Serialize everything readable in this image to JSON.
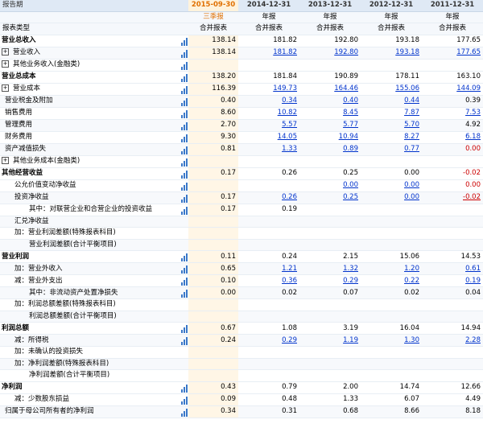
{
  "header": {
    "period_label": "报告期",
    "type_label": "报表类型",
    "periods": [
      "2015-09-30",
      "2014-12-31",
      "2013-12-31",
      "2012-12-31",
      "2011-12-31"
    ],
    "period_types": [
      "三季报",
      "年报",
      "年报",
      "年报",
      "年报"
    ],
    "report_types": [
      "合并报表",
      "合并报表",
      "合并报表",
      "合并报表",
      "合并报表"
    ]
  },
  "rows": [
    {
      "label": "营业总收入",
      "indent": 0,
      "bold": true,
      "expand": false,
      "chart": true,
      "values": [
        "138.14",
        "181.82",
        "192.80",
        "193.18",
        "177.65"
      ],
      "links": [
        false,
        false,
        false,
        false,
        false
      ]
    },
    {
      "label": "营业收入",
      "indent": 1,
      "bold": false,
      "expand": true,
      "chart": true,
      "values": [
        "138.14",
        "181.82",
        "192.80",
        "193.18",
        "177.65"
      ],
      "links": [
        false,
        true,
        true,
        true,
        true
      ]
    },
    {
      "label": "其他业务收入(金融类)",
      "indent": 1,
      "bold": false,
      "expand": true,
      "chart": true,
      "values": [
        "",
        "",
        "",
        "",
        ""
      ],
      "links": [
        false,
        false,
        false,
        false,
        false
      ]
    },
    {
      "label": "营业总成本",
      "indent": 0,
      "bold": true,
      "expand": false,
      "chart": true,
      "values": [
        "138.20",
        "181.84",
        "190.89",
        "178.11",
        "163.10"
      ],
      "links": [
        false,
        false,
        false,
        false,
        false
      ]
    },
    {
      "label": "营业成本",
      "indent": 1,
      "bold": false,
      "expand": true,
      "chart": true,
      "values": [
        "116.39",
        "149.73",
        "164.46",
        "155.06",
        "144.09"
      ],
      "links": [
        false,
        true,
        true,
        true,
        true
      ]
    },
    {
      "label": "营业税金及附加",
      "indent": 1,
      "bold": false,
      "expand": false,
      "chart": true,
      "values": [
        "0.40",
        "0.34",
        "0.40",
        "0.44",
        "0.39"
      ],
      "links": [
        false,
        true,
        true,
        true,
        false
      ]
    },
    {
      "label": "销售费用",
      "indent": 1,
      "bold": false,
      "expand": false,
      "chart": true,
      "values": [
        "8.60",
        "10.82",
        "8.45",
        "7.87",
        "7.53"
      ],
      "links": [
        false,
        true,
        true,
        true,
        true
      ]
    },
    {
      "label": "管理费用",
      "indent": 1,
      "bold": false,
      "expand": false,
      "chart": true,
      "values": [
        "2.70",
        "5.57",
        "5.77",
        "5.70",
        "4.92"
      ],
      "links": [
        false,
        true,
        true,
        true,
        false
      ]
    },
    {
      "label": "财务费用",
      "indent": 1,
      "bold": false,
      "expand": false,
      "chart": true,
      "values": [
        "9.30",
        "14.05",
        "10.94",
        "8.27",
        "6.18"
      ],
      "links": [
        false,
        true,
        true,
        true,
        true
      ]
    },
    {
      "label": "资产减值损失",
      "indent": 1,
      "bold": false,
      "expand": false,
      "chart": true,
      "values": [
        "0.81",
        "1.33",
        "0.89",
        "0.77",
        "0.00"
      ],
      "links": [
        false,
        true,
        true,
        true,
        false
      ],
      "neg": [
        false,
        false,
        false,
        false,
        true
      ]
    },
    {
      "label": "其他业务成本(金融类)",
      "indent": 1,
      "bold": false,
      "expand": true,
      "chart": true,
      "values": [
        "",
        "",
        "",
        "",
        ""
      ],
      "links": [
        false,
        false,
        false,
        false,
        false
      ]
    },
    {
      "label": "其他经营收益",
      "indent": 0,
      "bold": true,
      "expand": false,
      "chart": true,
      "values": [
        "0.17",
        "0.26",
        "0.25",
        "0.00",
        "-0.02"
      ],
      "links": [
        false,
        false,
        false,
        false,
        false
      ],
      "neg": [
        false,
        false,
        false,
        false,
        true
      ]
    },
    {
      "label": "公允价值变动净收益",
      "indent": 2,
      "bold": false,
      "expand": false,
      "chart": true,
      "values": [
        "",
        "",
        "0.00",
        "0.00",
        "0.00"
      ],
      "links": [
        false,
        false,
        true,
        true,
        false
      ],
      "neg": [
        false,
        false,
        false,
        false,
        true
      ]
    },
    {
      "label": "投资净收益",
      "indent": 2,
      "bold": false,
      "expand": false,
      "chart": true,
      "values": [
        "0.17",
        "0.26",
        "0.25",
        "0.00",
        "-0.02"
      ],
      "links": [
        false,
        true,
        true,
        true,
        true
      ],
      "neg": [
        false,
        false,
        false,
        false,
        true
      ]
    },
    {
      "label": "其中：对联营企业和合营企业的投资收益",
      "indent": 3,
      "bold": false,
      "expand": false,
      "chart": true,
      "values": [
        "0.17",
        "0.19",
        "",
        "",
        ""
      ],
      "links": [
        false,
        false,
        false,
        false,
        false
      ]
    },
    {
      "label": "汇兑净收益",
      "indent": 2,
      "bold": false,
      "expand": false,
      "chart": false,
      "values": [
        "",
        "",
        "",
        "",
        ""
      ],
      "links": [
        false,
        false,
        false,
        false,
        false
      ]
    },
    {
      "label": "加：营业利润差额(特殊报表科目)",
      "indent": 2,
      "bold": false,
      "expand": false,
      "chart": false,
      "values": [
        "",
        "",
        "",
        "",
        ""
      ],
      "links": [
        false,
        false,
        false,
        false,
        false
      ]
    },
    {
      "label": "营业利润差额(合计平衡项目)",
      "indent": 3,
      "bold": false,
      "expand": false,
      "chart": false,
      "values": [
        "",
        "",
        "",
        "",
        ""
      ],
      "links": [
        false,
        false,
        false,
        false,
        false
      ]
    },
    {
      "label": "营业利润",
      "indent": 0,
      "bold": true,
      "expand": false,
      "chart": true,
      "values": [
        "0.11",
        "0.24",
        "2.15",
        "15.06",
        "14.53"
      ],
      "links": [
        false,
        false,
        false,
        false,
        false
      ]
    },
    {
      "label": "加：营业外收入",
      "indent": 2,
      "bold": false,
      "expand": false,
      "chart": true,
      "values": [
        "0.65",
        "1.21",
        "1.32",
        "1.20",
        "0.61"
      ],
      "links": [
        false,
        true,
        true,
        true,
        true
      ]
    },
    {
      "label": "减：营业外支出",
      "indent": 2,
      "bold": false,
      "expand": false,
      "chart": true,
      "values": [
        "0.10",
        "0.36",
        "0.29",
        "0.22",
        "0.19"
      ],
      "links": [
        false,
        true,
        true,
        true,
        true
      ]
    },
    {
      "label": "其中：非流动资产处置净损失",
      "indent": 3,
      "bold": false,
      "expand": false,
      "chart": true,
      "values": [
        "0.00",
        "0.02",
        "0.07",
        "0.02",
        "0.04"
      ],
      "links": [
        false,
        false,
        false,
        false,
        false
      ]
    },
    {
      "label": "加：利润总额差额(特殊报表科目)",
      "indent": 2,
      "bold": false,
      "expand": false,
      "chart": false,
      "values": [
        "",
        "",
        "",
        "",
        ""
      ],
      "links": [
        false,
        false,
        false,
        false,
        false
      ]
    },
    {
      "label": "利润总额差额(合计平衡项目)",
      "indent": 3,
      "bold": false,
      "expand": false,
      "chart": false,
      "values": [
        "",
        "",
        "",
        "",
        ""
      ],
      "links": [
        false,
        false,
        false,
        false,
        false
      ]
    },
    {
      "label": "利润总额",
      "indent": 0,
      "bold": true,
      "expand": false,
      "chart": true,
      "values": [
        "0.67",
        "1.08",
        "3.19",
        "16.04",
        "14.94"
      ],
      "links": [
        false,
        false,
        false,
        false,
        false
      ]
    },
    {
      "label": "减：所得税",
      "indent": 2,
      "bold": false,
      "expand": false,
      "chart": true,
      "values": [
        "0.24",
        "0.29",
        "1.19",
        "1.30",
        "2.28"
      ],
      "links": [
        false,
        true,
        true,
        true,
        true
      ]
    },
    {
      "label": "加：未确认的投资损失",
      "indent": 2,
      "bold": false,
      "expand": false,
      "chart": false,
      "values": [
        "",
        "",
        "",
        "",
        ""
      ],
      "links": [
        false,
        false,
        false,
        false,
        false
      ]
    },
    {
      "label": "加：净利润差额(特殊报表科目)",
      "indent": 2,
      "bold": false,
      "expand": false,
      "chart": false,
      "values": [
        "",
        "",
        "",
        "",
        ""
      ],
      "links": [
        false,
        false,
        false,
        false,
        false
      ]
    },
    {
      "label": "净利润差额(合计平衡项目)",
      "indent": 3,
      "bold": false,
      "expand": false,
      "chart": false,
      "values": [
        "",
        "",
        "",
        "",
        ""
      ],
      "links": [
        false,
        false,
        false,
        false,
        false
      ]
    },
    {
      "label": "净利润",
      "indent": 0,
      "bold": true,
      "expand": false,
      "chart": true,
      "values": [
        "0.43",
        "0.79",
        "2.00",
        "14.74",
        "12.66"
      ],
      "links": [
        false,
        false,
        false,
        false,
        false
      ]
    },
    {
      "label": "减：少数股东损益",
      "indent": 2,
      "bold": false,
      "expand": false,
      "chart": true,
      "values": [
        "0.09",
        "0.48",
        "1.33",
        "6.07",
        "4.49"
      ],
      "links": [
        false,
        false,
        false,
        false,
        false
      ]
    },
    {
      "label": "归属于母公司所有者的净利润",
      "indent": 1,
      "bold": false,
      "expand": false,
      "chart": true,
      "values": [
        "0.34",
        "0.31",
        "0.68",
        "8.66",
        "8.18"
      ],
      "links": [
        false,
        false,
        false,
        false,
        false
      ]
    }
  ]
}
